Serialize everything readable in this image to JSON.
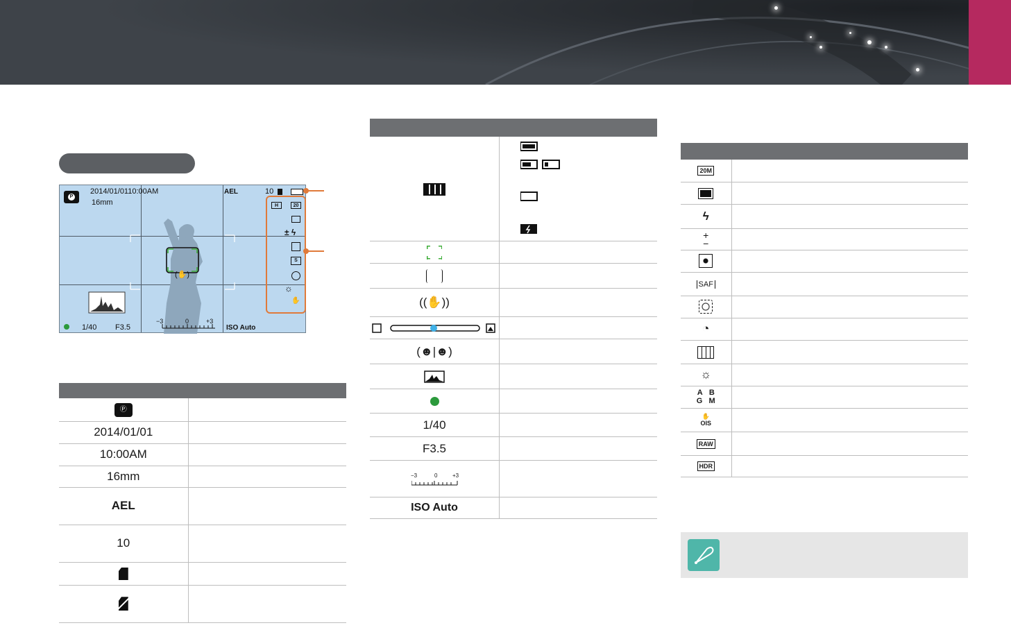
{
  "colors": {
    "banner": "#3d4248",
    "accent_tab": "#b5295f",
    "table_header": "#6d6f72",
    "callout": "#e07a3a",
    "note_bg": "#e6e6e6",
    "note_icon": "#4fb6a9"
  },
  "screen": {
    "datetime": "2014/01/0110:00AM",
    "focal": "16mm",
    "ael": "AEL",
    "shots": "10",
    "shutter": "1/40",
    "aperture": "F3.5",
    "exp_minus": "−3",
    "exp_zero": "0",
    "exp_plus": "+3",
    "iso": "ISO Auto",
    "icons": [
      "camera-mode-icon",
      "card-icon",
      "battery-icon",
      "hdr-icon",
      "size-20m-icon",
      "quality-icon",
      "flash-icon",
      "metering-icon",
      "saf-icon",
      "face-icon",
      "wb-icon",
      "ois-icon"
    ]
  },
  "table1": {
    "rows": [
      {
        "icon": "camera-p-icon"
      },
      {
        "text": "2014/01/01"
      },
      {
        "text": "10:00AM"
      },
      {
        "text": "16mm"
      },
      {
        "text": "AEL"
      },
      {
        "text": "10"
      },
      {
        "icon": "memory-card-icon"
      },
      {
        "icon": "no-card-icon"
      }
    ]
  },
  "table2": {
    "rows": [
      {
        "icon": "battery-icon"
      },
      {
        "icon": "af-frame-icon"
      },
      {
        "icon": "spot-af-frame-icon"
      },
      {
        "icon": "shake-icon"
      },
      {
        "icon": "slider-icon"
      },
      {
        "icon": "face-detect-icon"
      },
      {
        "icon": "histogram-icon"
      },
      {
        "icon": "green-dot-icon"
      },
      {
        "text": "1/40"
      },
      {
        "text": "F3.5"
      },
      {
        "scale": [
          "−3",
          "0",
          "+3"
        ]
      },
      {
        "text": "ISO Auto"
      }
    ]
  },
  "table3": {
    "rows": [
      {
        "icon": "size-20m-icon",
        "label": "20M"
      },
      {
        "icon": "quality-icon"
      },
      {
        "icon": "flash-icon"
      },
      {
        "icon": "flash-comp-icon"
      },
      {
        "icon": "metering-icon"
      },
      {
        "icon": "saf-icon",
        "label": "SAF"
      },
      {
        "icon": "face-af-icon"
      },
      {
        "icon": "smart-filter-icon"
      },
      {
        "icon": "grid-icon"
      },
      {
        "icon": "white-balance-icon"
      },
      {
        "icon": "ab-gm-icon",
        "a": "A",
        "b": "B",
        "g": "G",
        "m": "M"
      },
      {
        "icon": "ois-icon",
        "label": "OIS"
      },
      {
        "icon": "raw-icon",
        "label": "RAW"
      },
      {
        "icon": "hdr-icon",
        "label": "HDR"
      }
    ]
  }
}
